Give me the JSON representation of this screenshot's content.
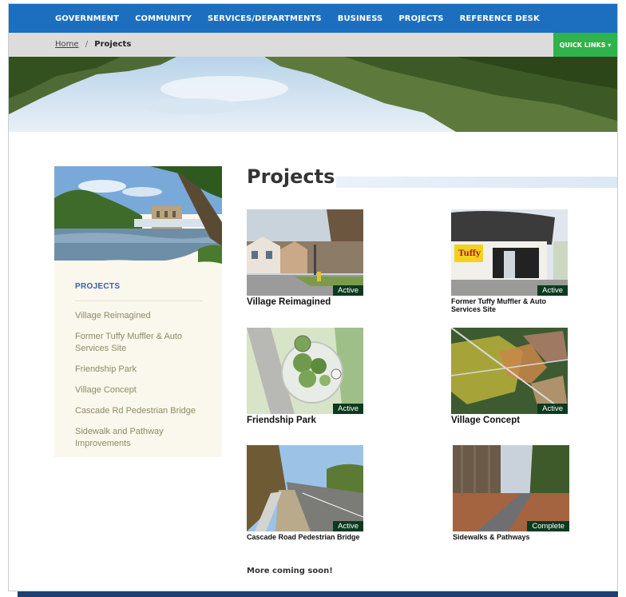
{
  "nav": {
    "items": [
      "GOVERNMENT",
      "COMMUNITY",
      "SERVICES/DEPARTMENTS",
      "BUSINESS",
      "PROJECTS",
      "REFERENCE DESK"
    ]
  },
  "breadcrumb": {
    "home": "Home",
    "separator": "/",
    "current": "Projects"
  },
  "quick_links": "QUICK LINKS ▾",
  "sidebar": {
    "title": "PROJECTS",
    "items": [
      "Village Reimagined",
      "Former Tuffy Muffler & Auto Services Site",
      "Friendship Park",
      "Village Concept",
      "Cascade Rd Pedestrian Bridge",
      "Sidewalk and Pathway Improvements"
    ]
  },
  "page_title": "Projects",
  "cards": [
    {
      "caption": "Village Reimagined",
      "status": "Active"
    },
    {
      "caption": "Former Tuffy Muffler & Auto Services Site",
      "status": "Active"
    },
    {
      "caption": "Friendship Park",
      "status": "Active"
    },
    {
      "caption": "Village Concept",
      "status": "Active"
    },
    {
      "caption": "Cascade Road Pedestrian Bridge",
      "status": "Active"
    },
    {
      "caption": "Sidewalks & Pathways",
      "status": "Complete"
    }
  ],
  "more_coming": "More coming soon!",
  "colors": {
    "nav_bg": "#1c6fbf",
    "quick_links_bg": "#2fb34a",
    "badge_bg": "#0b3b1f",
    "sidebar_title": "#2f62b5"
  }
}
